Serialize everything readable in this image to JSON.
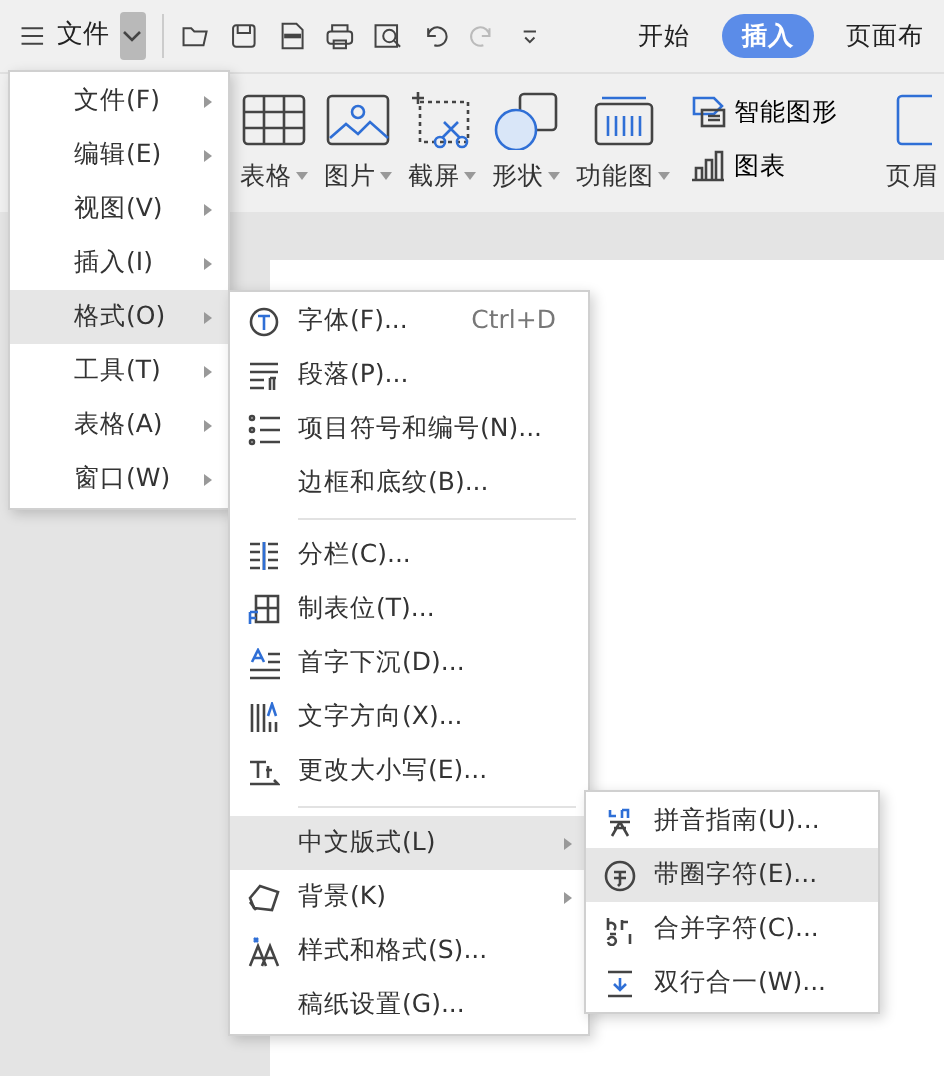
{
  "toolbar": {
    "menu_label": "文件",
    "tabs": [
      {
        "label": "开始",
        "selected": false
      },
      {
        "label": "插入",
        "selected": true
      },
      {
        "label": "页面布",
        "selected": false
      }
    ]
  },
  "ribbon": {
    "large_buttons": [
      {
        "label": "表格",
        "dropdown": true
      },
      {
        "label": "图片",
        "dropdown": true
      },
      {
        "label": "截屏",
        "dropdown": true
      },
      {
        "label": "形状",
        "dropdown": true
      },
      {
        "label": "功能图",
        "dropdown": true
      }
    ],
    "small_buttons": [
      {
        "label": "智能图形"
      },
      {
        "label": "图表"
      }
    ],
    "cut_button": {
      "label": "页眉"
    }
  },
  "menu": {
    "items": [
      {
        "label": "文件(F)",
        "selected": false
      },
      {
        "label": "编辑(E)",
        "selected": false
      },
      {
        "label": "视图(V)",
        "selected": false
      },
      {
        "label": "插入(I)",
        "selected": false
      },
      {
        "label": "格式(O)",
        "selected": true
      },
      {
        "label": "工具(T)",
        "selected": false
      },
      {
        "label": "表格(A)",
        "selected": false
      },
      {
        "label": "窗口(W)",
        "selected": false
      }
    ]
  },
  "format_menu": {
    "items": [
      {
        "kind": "item",
        "label": "字体(F)...",
        "shortcut": "Ctrl+D",
        "selected": false,
        "submenu": false
      },
      {
        "kind": "item",
        "label": "段落(P)...",
        "selected": false,
        "submenu": false
      },
      {
        "kind": "item",
        "label": "项目符号和编号(N)...",
        "selected": false,
        "submenu": false
      },
      {
        "kind": "item",
        "label": "边框和底纹(B)...",
        "selected": false,
        "submenu": false
      },
      {
        "kind": "separator"
      },
      {
        "kind": "item",
        "label": "分栏(C)...",
        "selected": false,
        "submenu": false
      },
      {
        "kind": "item",
        "label": "制表位(T)...",
        "selected": false,
        "submenu": false
      },
      {
        "kind": "item",
        "label": "首字下沉(D)...",
        "selected": false,
        "submenu": false
      },
      {
        "kind": "item",
        "label": "文字方向(X)...",
        "selected": false,
        "submenu": false
      },
      {
        "kind": "item",
        "label": "更改大小写(E)...",
        "selected": false,
        "submenu": false
      },
      {
        "kind": "separator"
      },
      {
        "kind": "item",
        "label": "中文版式(L)",
        "selected": true,
        "submenu": true
      },
      {
        "kind": "item",
        "label": "背景(K)",
        "selected": false,
        "submenu": true
      },
      {
        "kind": "item",
        "label": "样式和格式(S)...",
        "selected": false,
        "submenu": false
      },
      {
        "kind": "item",
        "label": "稿纸设置(G)...",
        "selected": false,
        "submenu": false
      }
    ]
  },
  "chinese_layout_menu": {
    "items": [
      {
        "label": "拼音指南(U)...",
        "selected": false
      },
      {
        "label": "带圈字符(E)...",
        "selected": true
      },
      {
        "label": "合并字符(C)...",
        "selected": false
      },
      {
        "label": "双行合一(W)...",
        "selected": false
      }
    ]
  }
}
